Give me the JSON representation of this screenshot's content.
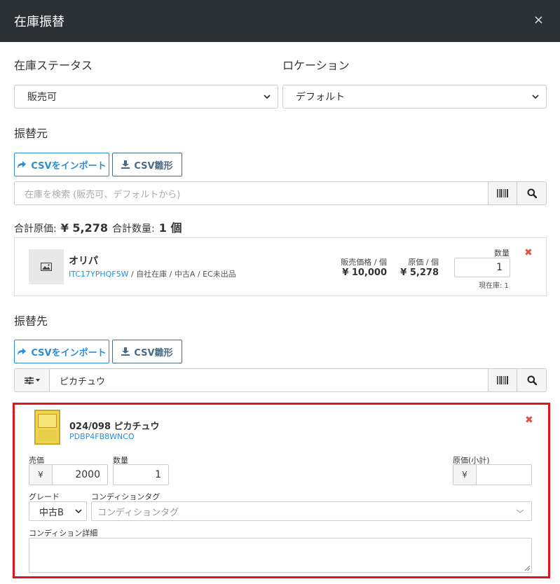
{
  "modal": {
    "title": "在庫振替",
    "close_label": "×"
  },
  "filters": {
    "status_label": "在庫ステータス",
    "status_value": "販売可",
    "location_label": "ロケーション",
    "location_value": "デフォルト"
  },
  "source": {
    "heading": "振替元",
    "import_label": "CSVをインポート",
    "template_label": "CSV雛形",
    "search_placeholder": "在庫を検索 (販売可、デフォルトから)",
    "totals": {
      "cost_label": "合計原価:",
      "cost_value": "¥ 5,278",
      "qty_label": "合計数量:",
      "qty_value": "1 個"
    },
    "item": {
      "name": "オリパ",
      "code": "ITC17YPHQF5W",
      "meta": " / 自社在庫 / 中古A / EC未出品",
      "price_label": "販売価格 / 個",
      "price_value": "¥ 10,000",
      "cost_label": "原価 / 個",
      "cost_value": "¥ 5,278",
      "qty_label": "数量",
      "qty_value": "1",
      "stock_note": "現在庫: 1"
    }
  },
  "destination": {
    "heading": "振替先",
    "import_label": "CSVをインポート",
    "template_label": "CSV雛形",
    "search_value": "ピカチュウ",
    "item": {
      "name": "024/098 ピカチュウ",
      "code": "PDBP4FB8WNCO",
      "price_label": "売価",
      "currency": "¥",
      "price_value": "2000",
      "qty_label": "数量",
      "qty_value": "1",
      "cost_label": "原価(小計)",
      "cost_currency": "¥",
      "cost_value": "",
      "grade_label": "グレード",
      "grade_value": "中古B",
      "tag_label": "コンディションタグ",
      "tag_placeholder": "コンディションタグ",
      "detail_label": "コンディション詳細"
    }
  },
  "colors": {
    "header_bg": "#2b3035",
    "link_blue": "#2c8ed4",
    "highlight_red": "#e0141e",
    "delete_red": "#d9534f"
  }
}
